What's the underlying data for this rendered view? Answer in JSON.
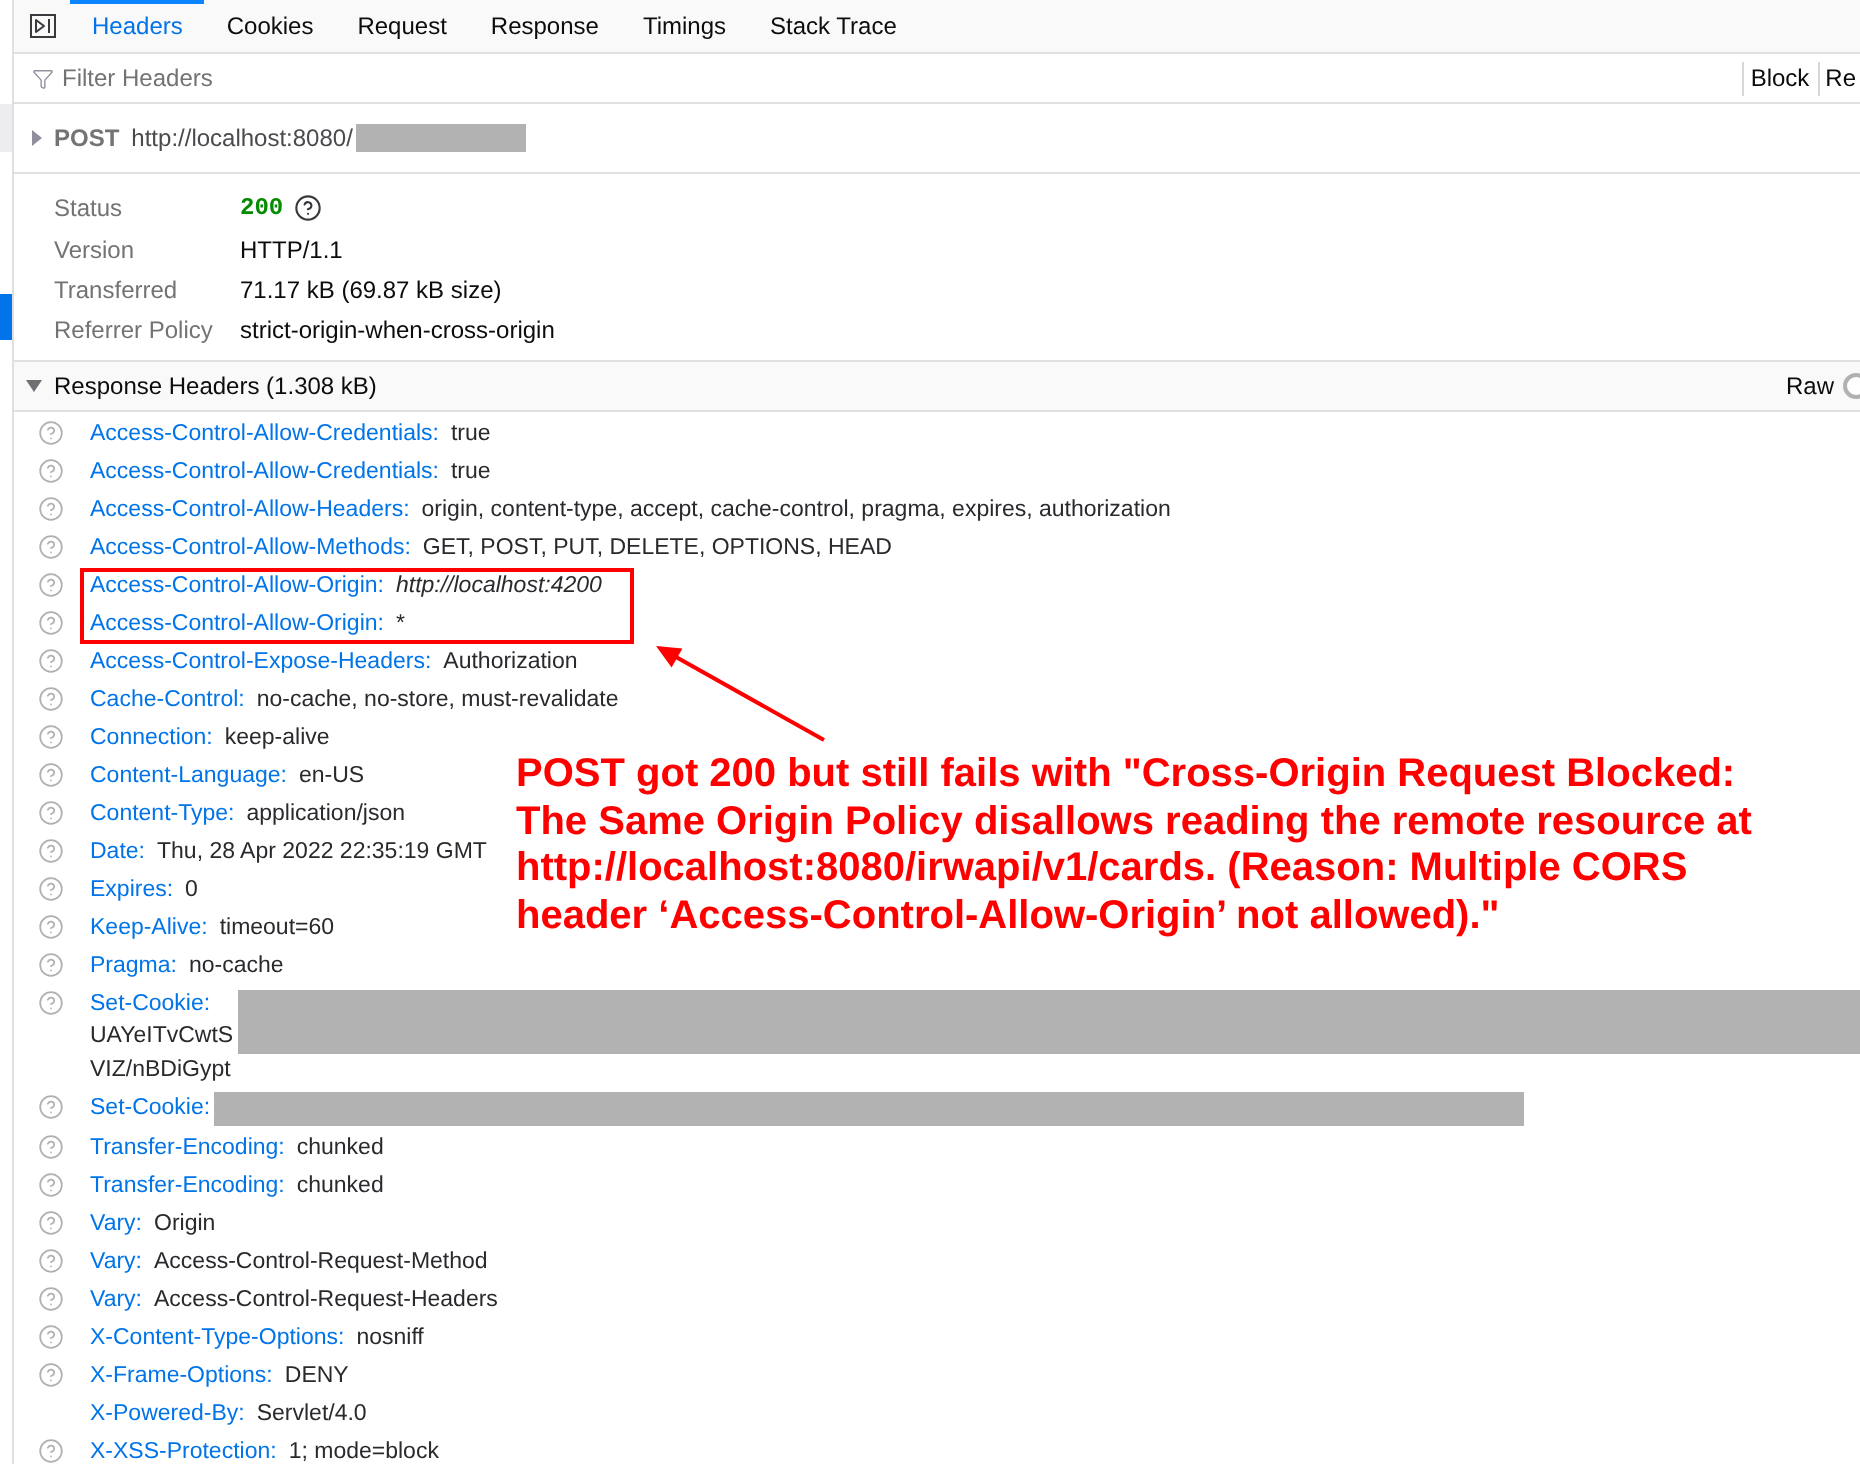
{
  "tabs": [
    {
      "label": "Headers",
      "selected": true
    },
    {
      "label": "Cookies",
      "selected": false
    },
    {
      "label": "Request",
      "selected": false
    },
    {
      "label": "Response",
      "selected": false
    },
    {
      "label": "Timings",
      "selected": false
    },
    {
      "label": "Stack Trace",
      "selected": false
    }
  ],
  "filter": {
    "placeholder": "Filter Headers"
  },
  "toolbar_buttons": [
    "Block",
    "Re"
  ],
  "request": {
    "method": "POST",
    "url": "http://localhost:8080/",
    "expanded": false,
    "redacted": true
  },
  "summary": [
    {
      "label": "Status",
      "value": "200",
      "kind": "status"
    },
    {
      "label": "Version",
      "value": "HTTP/1.1",
      "kind": "text"
    },
    {
      "label": "Transferred",
      "value": "71.17 kB (69.87 kB size)",
      "kind": "text"
    },
    {
      "label": "Referrer Policy",
      "value": "strict-origin-when-cross-origin",
      "kind": "text"
    }
  ],
  "response_headers": {
    "title": "Response Headers (1.308 kB)",
    "expanded": true,
    "raw": {
      "label": "Raw",
      "on": false
    },
    "rows": [
      {
        "name": "Access-Control-Allow-Credentials:",
        "value": "true",
        "help_icon": true,
        "italic": false,
        "redacted": false
      },
      {
        "name": "Access-Control-Allow-Credentials:",
        "value": "true",
        "help_icon": true,
        "italic": false,
        "redacted": false
      },
      {
        "name": "Access-Control-Allow-Headers:",
        "value": "origin, content-type, accept, cache-control, pragma, expires, authorization",
        "help_icon": true,
        "italic": false,
        "redacted": false
      },
      {
        "name": "Access-Control-Allow-Methods:",
        "value": "GET, POST, PUT, DELETE, OPTIONS, HEAD",
        "help_icon": true,
        "italic": false,
        "redacted": false
      },
      {
        "name": "Access-Control-Allow-Origin:",
        "value": "http://localhost:4200",
        "help_icon": true,
        "italic": true,
        "redacted": false
      },
      {
        "name": "Access-Control-Allow-Origin:",
        "value": "*",
        "help_icon": true,
        "italic": false,
        "redacted": false
      },
      {
        "name": "Access-Control-Expose-Headers:",
        "value": "Authorization",
        "help_icon": true,
        "italic": false,
        "redacted": false
      },
      {
        "name": "Cache-Control:",
        "value": "no-cache, no-store, must-revalidate",
        "help_icon": true,
        "italic": false,
        "redacted": false
      },
      {
        "name": "Connection:",
        "value": "keep-alive",
        "help_icon": true,
        "italic": false,
        "redacted": false
      },
      {
        "name": "Content-Language:",
        "value": "en-US",
        "help_icon": true,
        "italic": false,
        "redacted": false
      },
      {
        "name": "Content-Type:",
        "value": "application/json",
        "help_icon": true,
        "italic": false,
        "redacted": false
      },
      {
        "name": "Date:",
        "value": "Thu, 28 Apr 2022 22:35:19 GMT",
        "help_icon": true,
        "italic": false,
        "redacted": false
      },
      {
        "name": "Expires:",
        "value": "0",
        "help_icon": true,
        "italic": false,
        "redacted": false
      },
      {
        "name": "Keep-Alive:",
        "value": "timeout=60",
        "help_icon": true,
        "italic": false,
        "redacted": false
      },
      {
        "name": "Pragma:",
        "value": "no-cache",
        "help_icon": true,
        "italic": false,
        "redacted": false
      },
      {
        "name": "Set-Cookie:",
        "lines": [
          "UAYeITvCwtS",
          "VIZ/nBDiGypt"
        ],
        "help_icon": true,
        "italic": false,
        "redacted": true
      },
      {
        "name": "Set-Cookie:",
        "help_icon": true,
        "italic": false,
        "redacted": true
      },
      {
        "name": "Transfer-Encoding:",
        "value": "chunked",
        "help_icon": true,
        "italic": false,
        "redacted": false
      },
      {
        "name": "Transfer-Encoding:",
        "value": "chunked",
        "help_icon": true,
        "italic": false,
        "redacted": false
      },
      {
        "name": "Vary:",
        "value": "Origin",
        "help_icon": true,
        "italic": false,
        "redacted": false
      },
      {
        "name": "Vary:",
        "value": "Access-Control-Request-Method",
        "help_icon": true,
        "italic": false,
        "redacted": false
      },
      {
        "name": "Vary:",
        "value": "Access-Control-Request-Headers",
        "help_icon": true,
        "italic": false,
        "redacted": false
      },
      {
        "name": "X-Content-Type-Options:",
        "value": "nosniff",
        "help_icon": true,
        "italic": false,
        "redacted": false
      },
      {
        "name": "X-Frame-Options:",
        "value": "DENY",
        "help_icon": true,
        "italic": false,
        "redacted": false
      },
      {
        "name": "X-Powered-By:",
        "value": "Servlet/4.0",
        "help_icon": false,
        "italic": false,
        "redacted": false
      },
      {
        "name": "X-XSS-Protection:",
        "value": "1; mode=block",
        "help_icon": true,
        "italic": false,
        "redacted": false
      }
    ]
  },
  "annotation": {
    "lines": [
      "POST got 200 but still fails with \"Cross-Origin Request Blocked:",
      "The Same Origin Policy disallows reading the remote resource at",
      "http://localhost:8080/irwapi/v1/cards. (Reason: Multiple CORS",
      "header ‘Access-Control-Allow-Origin’ not allowed).\""
    ]
  }
}
